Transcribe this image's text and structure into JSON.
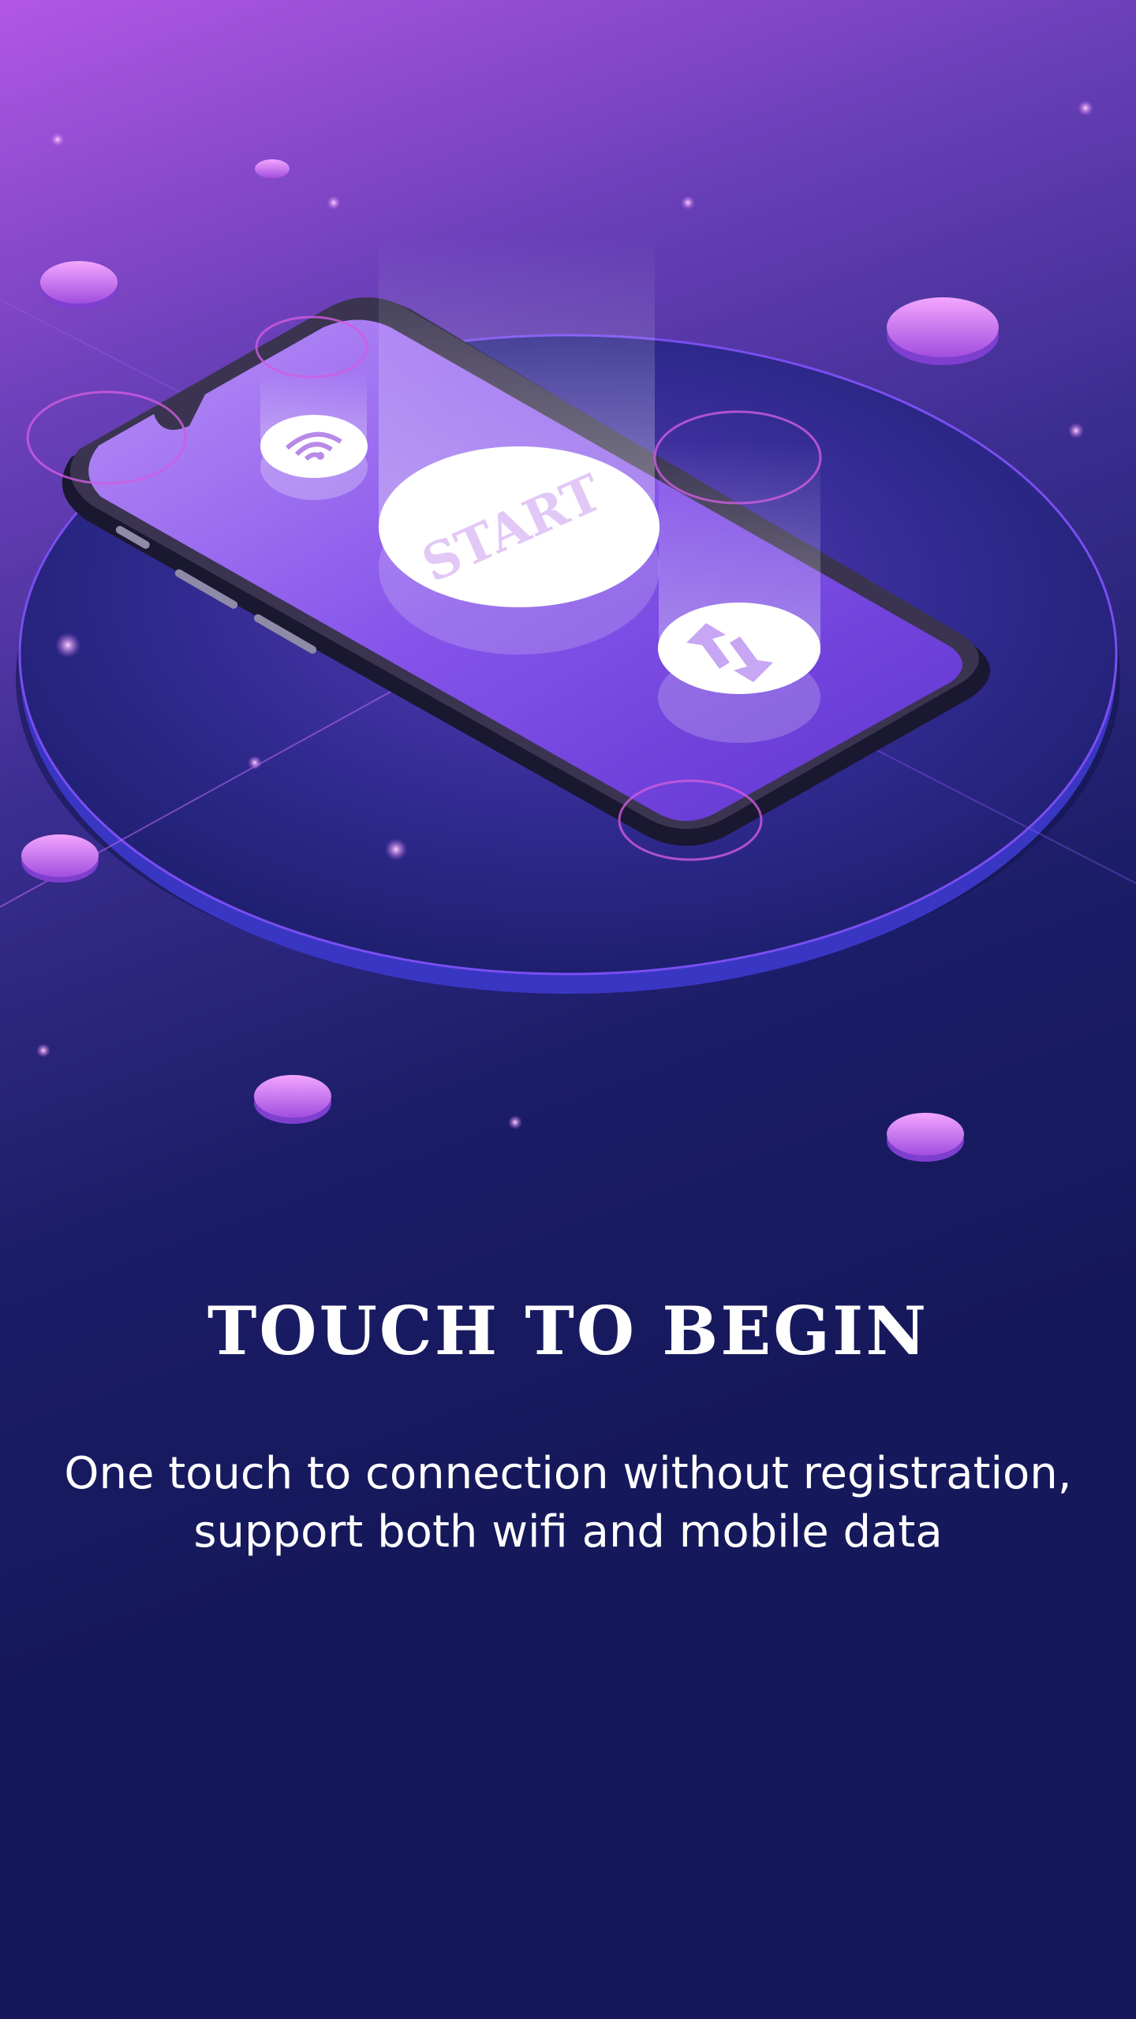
{
  "onboarding": {
    "hero": {
      "start_button_label": "START",
      "wifi_icon": "wifi-icon",
      "transfer_icon": "up-down-arrows-icon"
    },
    "title": "TOUCH TO BEGIN",
    "description_line1": "One touch to connection without registration,",
    "description_line2": "support both wifi and mobile data"
  },
  "colors": {
    "background_top": "#b257e6",
    "background_bottom": "#15185a",
    "accent_purple": "#8b55e8",
    "text": "#ffffff"
  }
}
